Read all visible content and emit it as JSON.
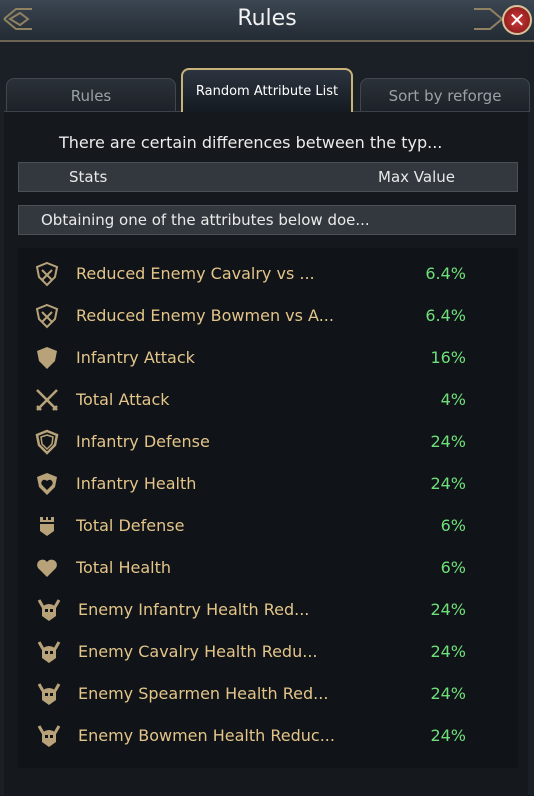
{
  "window": {
    "title": "Rules",
    "close_icon": "close-icon"
  },
  "tabs": [
    {
      "label": "Rules",
      "active": false
    },
    {
      "label": "Random Attribute List",
      "active": true
    },
    {
      "label": "Sort by reforge",
      "active": false
    }
  ],
  "intro_text": "There are certain differences between the typ...",
  "table_header": {
    "stats": "Stats",
    "max_value": "Max Value"
  },
  "note_text": "Obtaining one of the attributes below doe...",
  "colors": {
    "name": "#e3c58a",
    "value": "#6ee07a",
    "accent_border": "#c9b17a"
  },
  "attributes": [
    {
      "icon": "shield-crossed-icon",
      "name": "Reduced Enemy Cavalry vs ...",
      "value": "6.4%"
    },
    {
      "icon": "shield-crossed-icon",
      "name": "Reduced Enemy Bowmen vs A...",
      "value": "6.4%"
    },
    {
      "icon": "shield-icon",
      "name": "Infantry Attack",
      "value": "16%"
    },
    {
      "icon": "crossed-swords-icon",
      "name": "Total Attack",
      "value": "4%"
    },
    {
      "icon": "shield-outline-icon",
      "name": "Infantry Defense",
      "value": "24%"
    },
    {
      "icon": "shield-heart-icon",
      "name": "Infantry Health",
      "value": "24%"
    },
    {
      "icon": "tower-shield-icon",
      "name": "Total Defense",
      "value": "6%"
    },
    {
      "icon": "heart-icon",
      "name": "Total Health",
      "value": "6%"
    },
    {
      "icon": "horned-helmet-icon",
      "name": "Enemy Infantry Health Red...",
      "value": "24%"
    },
    {
      "icon": "horned-helmet-icon",
      "name": "Enemy Cavalry Health Redu...",
      "value": "24%"
    },
    {
      "icon": "horned-helmet-icon",
      "name": "Enemy Spearmen Health Red...",
      "value": "24%"
    },
    {
      "icon": "horned-helmet-icon",
      "name": "Enemy Bowmen Health Reduc...",
      "value": "24%"
    }
  ]
}
